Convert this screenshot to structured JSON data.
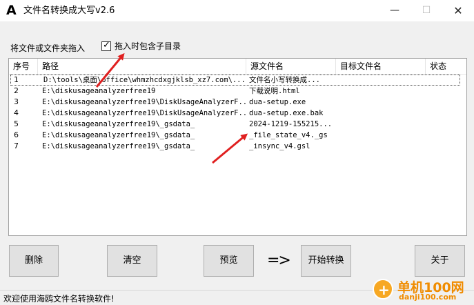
{
  "window": {
    "title": "文件名转换成大写v2.6",
    "app_icon_glyph": "A",
    "minimize_glyph": "—",
    "maximize_glyph": "☐",
    "close_glyph": "✕"
  },
  "drop_label": "将文件或文件夹拖入",
  "include_subdirs": {
    "label": "拖入时包含子目录",
    "checked": true,
    "tick_glyph": "✓"
  },
  "table": {
    "columns": [
      "序号",
      "路径",
      "源文件名",
      "目标文件名",
      "状态"
    ],
    "rows": [
      {
        "index": "1",
        "path": "D:\\tools\\桌面\\office\\whmzhcdxgjklsb_xz7.com\\...",
        "source": "文件名小写转换成...",
        "target": "",
        "status": ""
      },
      {
        "index": "2",
        "path": "E:\\diskusageanalyzerfree19",
        "source": "下载说明.html",
        "target": "",
        "status": ""
      },
      {
        "index": "3",
        "path": "E:\\diskusageanalyzerfree19\\DiskUsageAnalyzerF...",
        "source": "dua-setup.exe",
        "target": "",
        "status": ""
      },
      {
        "index": "4",
        "path": "E:\\diskusageanalyzerfree19\\DiskUsageAnalyzerF...",
        "source": "dua-setup.exe.bak",
        "target": "",
        "status": ""
      },
      {
        "index": "5",
        "path": "E:\\diskusageanalyzerfree19\\_gsdata_",
        "source": "2024-1219-155215...",
        "target": "",
        "status": ""
      },
      {
        "index": "6",
        "path": "E:\\diskusageanalyzerfree19\\_gsdata_",
        "source": "_file_state_v4._gs",
        "target": "",
        "status": ""
      },
      {
        "index": "7",
        "path": "E:\\diskusageanalyzerfree19\\_gsdata_",
        "source": "_insync_v4.gsl",
        "target": "",
        "status": ""
      }
    ]
  },
  "buttons": {
    "delete": "删除",
    "clear": "清空",
    "preview": "预览",
    "arrow": "=>",
    "start": "开始转换",
    "about": "关于"
  },
  "status_bar": "欢迎使用海鸥文件名转换软件!",
  "watermark": {
    "site_cn": "单机100网",
    "site_url": "danji100.com",
    "logo_glyph": "+"
  },
  "colors": {
    "annotation_arrow": "#e02020",
    "watermark": "#f08c00"
  }
}
